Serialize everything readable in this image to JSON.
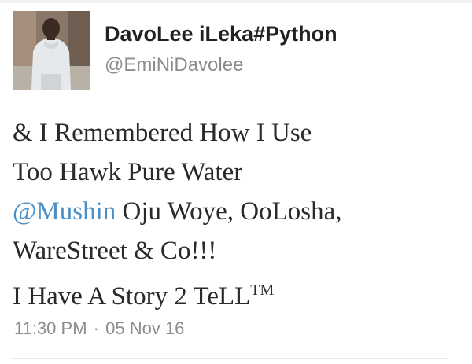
{
  "tweet": {
    "author": {
      "display_name": "DavoLee iLeka#Python",
      "handle": "@EmiNiDavolee"
    },
    "body": {
      "line1": "& I Remembered How I Use",
      "line2": "Too Hawk Pure Water",
      "mention": "@Mushin",
      "line3_rest": " Oju Woye, OoLosha,",
      "line4": "WareStreet & Co!!!",
      "line5": "I Have A Story 2 TeLL",
      "trademark": "TM"
    },
    "time": "11:30 PM",
    "separator": "·",
    "date": "05 Nov 16"
  },
  "colors": {
    "mention": "#4a90c8",
    "name": "#222222",
    "meta": "#8c8c8c"
  },
  "icons": {
    "avatar": "profile-photo"
  }
}
